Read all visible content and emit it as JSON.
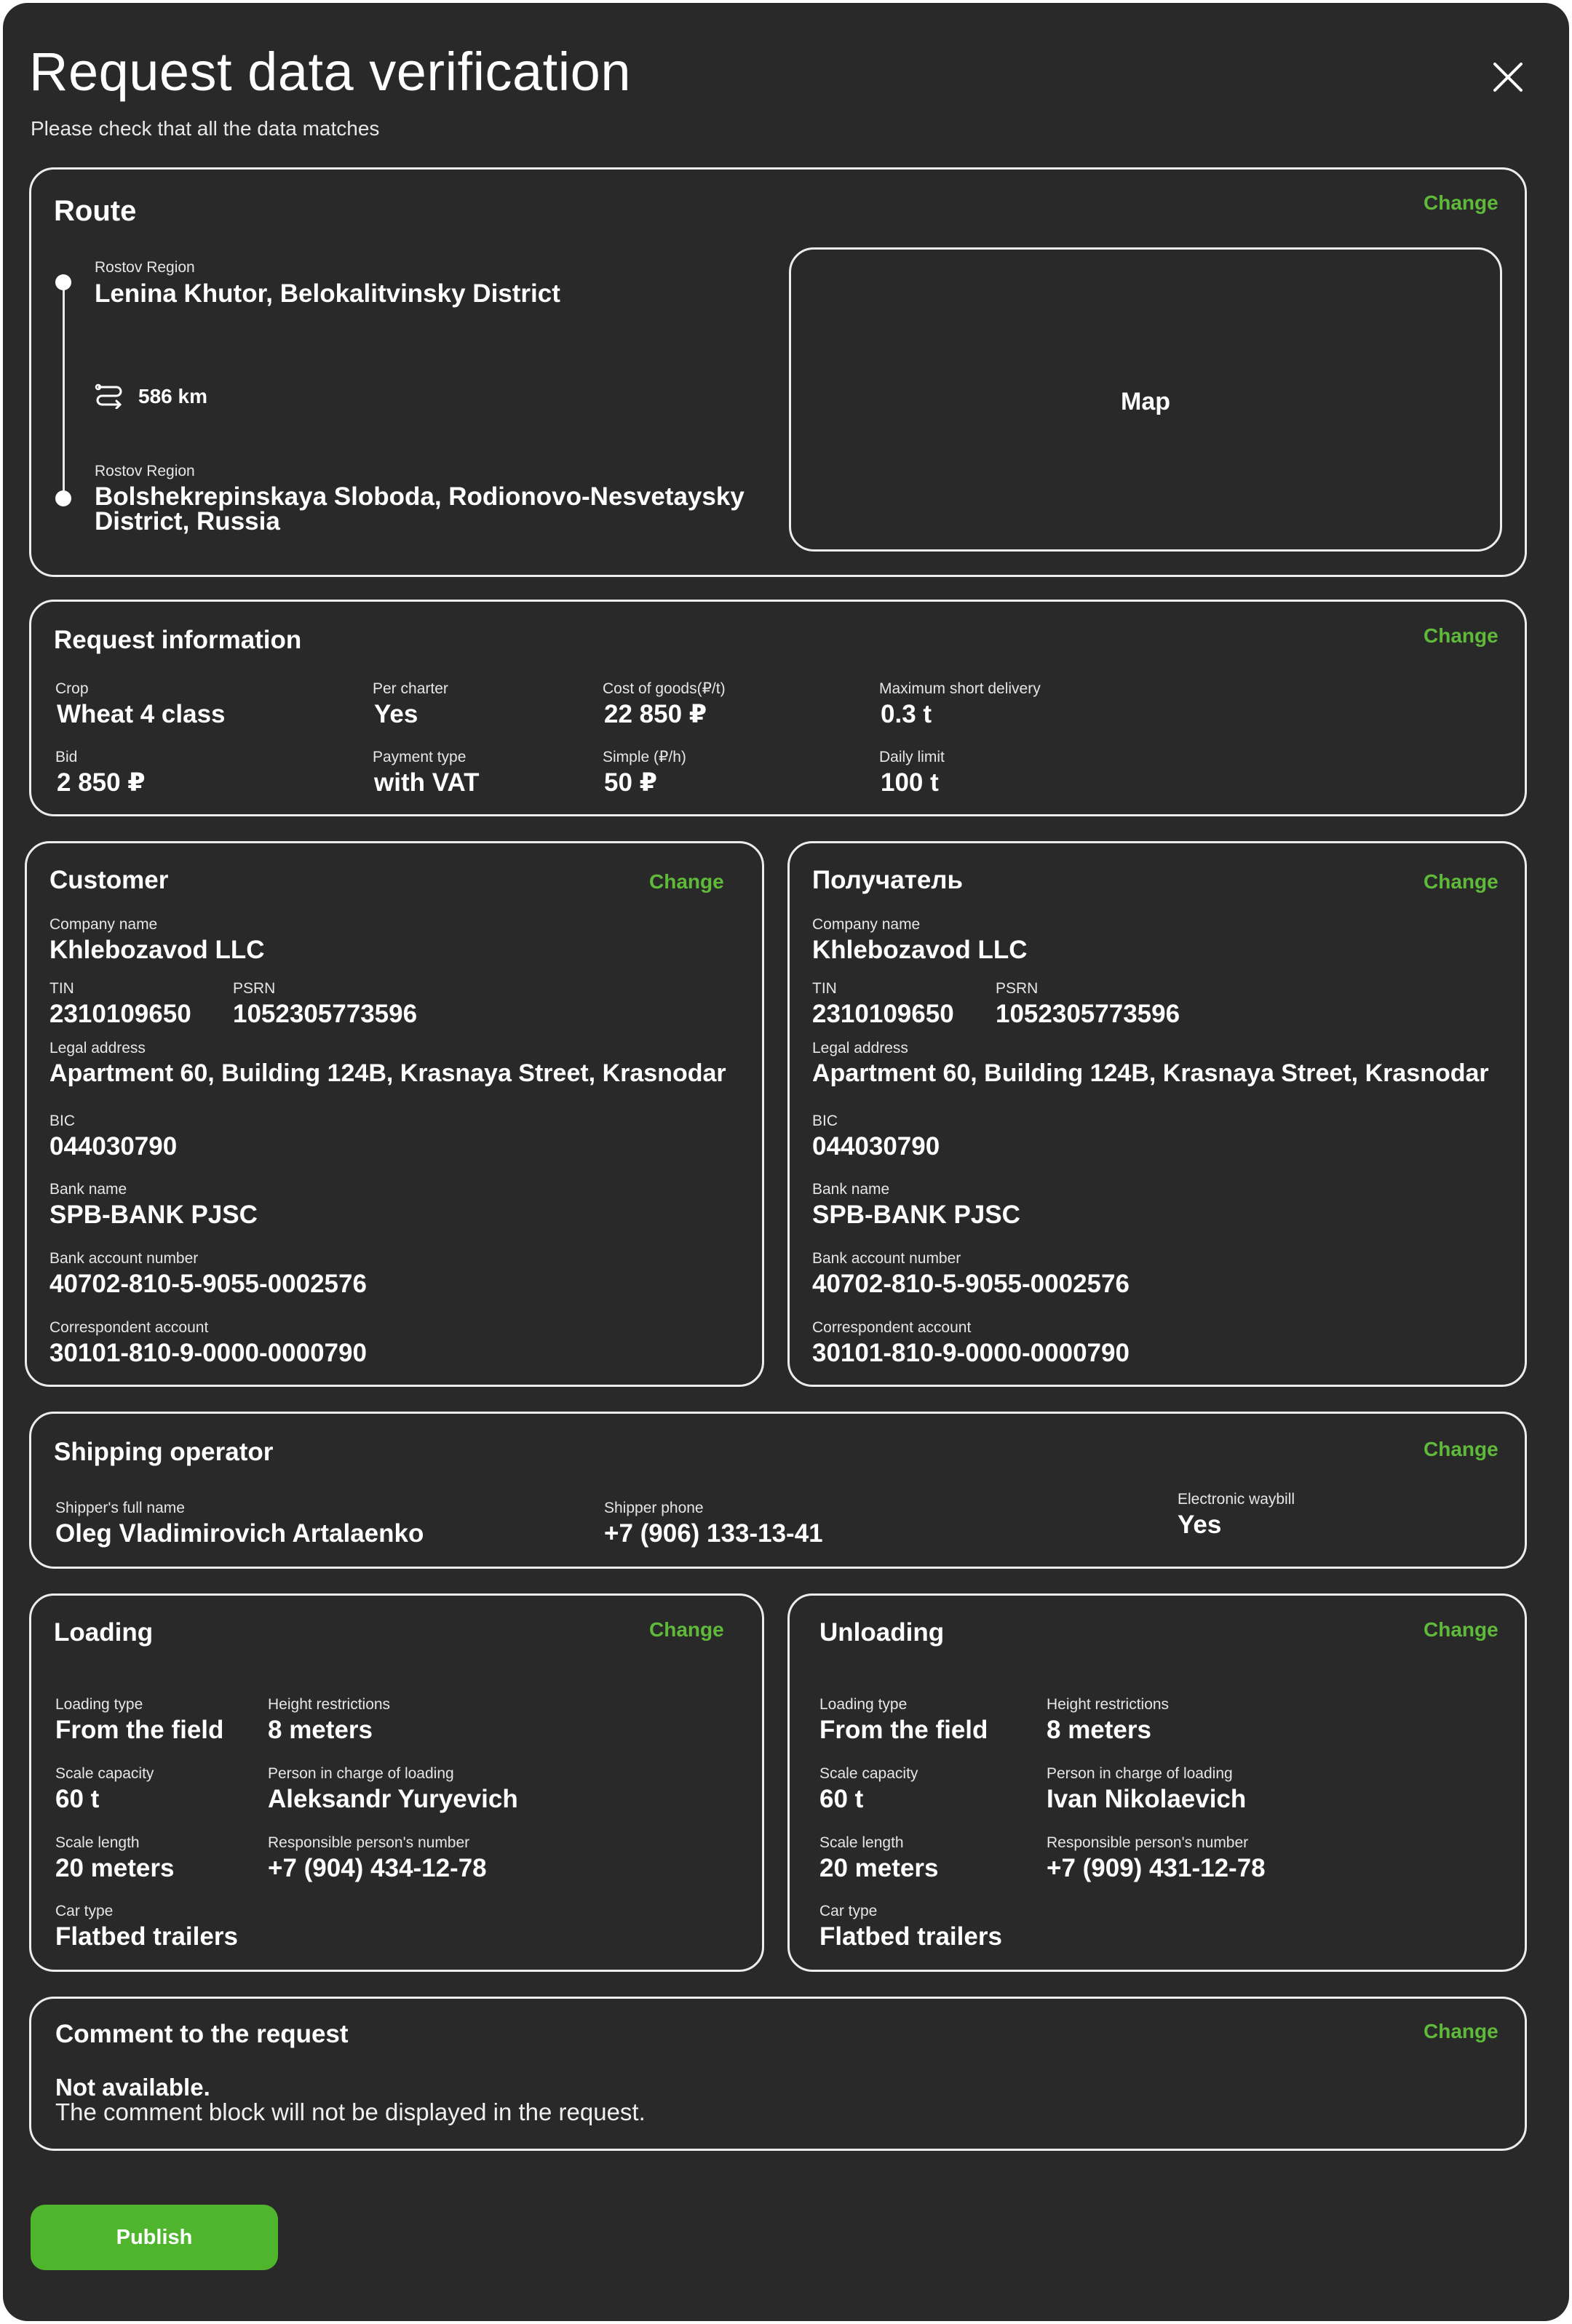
{
  "header": {
    "title": "Request data verification",
    "subtitle": "Please check that all the data matches"
  },
  "route": {
    "title": "Route",
    "change": "Change",
    "from_region": "Rostov Region",
    "from_place": "Lenina Khutor, Belokalitvinsky District",
    "distance": "586 km",
    "to_region": "Rostov Region",
    "to_place_line1": "Bolshekrepinskaya Sloboda, Rodionovo-Nesvetaysky",
    "to_place_line2": "District, Russia",
    "map_label": "Map"
  },
  "request_info": {
    "title": "Request information",
    "change": "Change",
    "fields": [
      {
        "label": "Crop",
        "value": "Wheat 4 class"
      },
      {
        "label": "Per charter",
        "value": "Yes"
      },
      {
        "label": "Cost of goods(₽/t)",
        "value": "22 850 ₽"
      },
      {
        "label": "Maximum short delivery",
        "value": "0.3 t"
      },
      {
        "label": "Bid",
        "value": "2 850 ₽"
      },
      {
        "label": "Payment type",
        "value": "with VAT"
      },
      {
        "label": "Simple (₽/h)",
        "value": "50 ₽"
      },
      {
        "label": "Daily limit",
        "value": "100 t"
      }
    ]
  },
  "customer": {
    "title": "Customer",
    "change": "Change",
    "company_label": "Company name",
    "company": "Khlebozavod LLC",
    "tin_label": "TIN",
    "tin": "2310109650",
    "psrn_label": "PSRN",
    "psrn": "1052305773596",
    "address_label": "Legal address",
    "address": "Apartment 60, Building 124B, Krasnaya Street, Krasnodar",
    "bic_label": "BIC",
    "bic": "044030790",
    "bank_label": "Bank name",
    "bank": "SPB-BANK PJSC",
    "account_label": "Bank account number",
    "account": "40702-810-5-9055-0002576",
    "corr_label": "Correspondent account",
    "corr": "30101-810-9-0000-0000790"
  },
  "recipient": {
    "title": "Получатель",
    "change": "Change",
    "company_label": "Company name",
    "company": "Khlebozavod LLC",
    "tin_label": "TIN",
    "tin": "2310109650",
    "psrn_label": "PSRN",
    "psrn": "1052305773596",
    "address_label": "Legal address",
    "address": "Apartment 60, Building 124B, Krasnaya Street, Krasnodar",
    "bic_label": "BIC",
    "bic": "044030790",
    "bank_label": "Bank name",
    "bank": "SPB-BANK PJSC",
    "account_label": "Bank account number",
    "account": "40702-810-5-9055-0002576",
    "corr_label": "Correspondent account",
    "corr": "30101-810-9-0000-0000790"
  },
  "shipping": {
    "title": "Shipping operator",
    "change": "Change",
    "name_label": "Shipper's full name",
    "name": "Oleg Vladimirovich Artalaenko",
    "phone_label": "Shipper phone",
    "phone": "+7 (906) 133-13-41",
    "waybill_label": "Electronic waybill",
    "waybill": "Yes"
  },
  "loading": {
    "title": "Loading",
    "change": "Change",
    "type_label": "Loading type",
    "type": "From the field",
    "height_label": "Height restrictions",
    "height": "8 meters",
    "scale_cap_label": "Scale capacity",
    "scale_cap": "60 t",
    "person_label": "Person in charge of loading",
    "person": "Aleksandr Yuryevich",
    "scale_len_label": "Scale length",
    "scale_len": "20 meters",
    "phone_label": "Responsible person's number",
    "phone": "+7 (904) 434-12-78",
    "car_label": "Car type",
    "car": "Flatbed trailers"
  },
  "unloading": {
    "title": "Unloading",
    "change": "Change",
    "type_label": "Loading type",
    "type": "From the field",
    "height_label": "Height restrictions",
    "height": "8 meters",
    "scale_cap_label": "Scale capacity",
    "scale_cap": "60 t",
    "person_label": "Person in charge of loading",
    "person": "Ivan Nikolaevich",
    "scale_len_label": "Scale length",
    "scale_len": "20 meters",
    "phone_label": "Responsible person's number",
    "phone": "+7 (909) 431-12-78",
    "car_label": "Car type",
    "car": "Flatbed trailers"
  },
  "comment": {
    "title": "Comment to the request",
    "change": "Change",
    "status": "Not available.",
    "note": "The comment block will not be displayed in the request."
  },
  "actions": {
    "publish": "Publish"
  },
  "colors": {
    "background": "#292929",
    "accent": "#5fba3a",
    "button": "#4fb52d",
    "border": "#ececec"
  }
}
